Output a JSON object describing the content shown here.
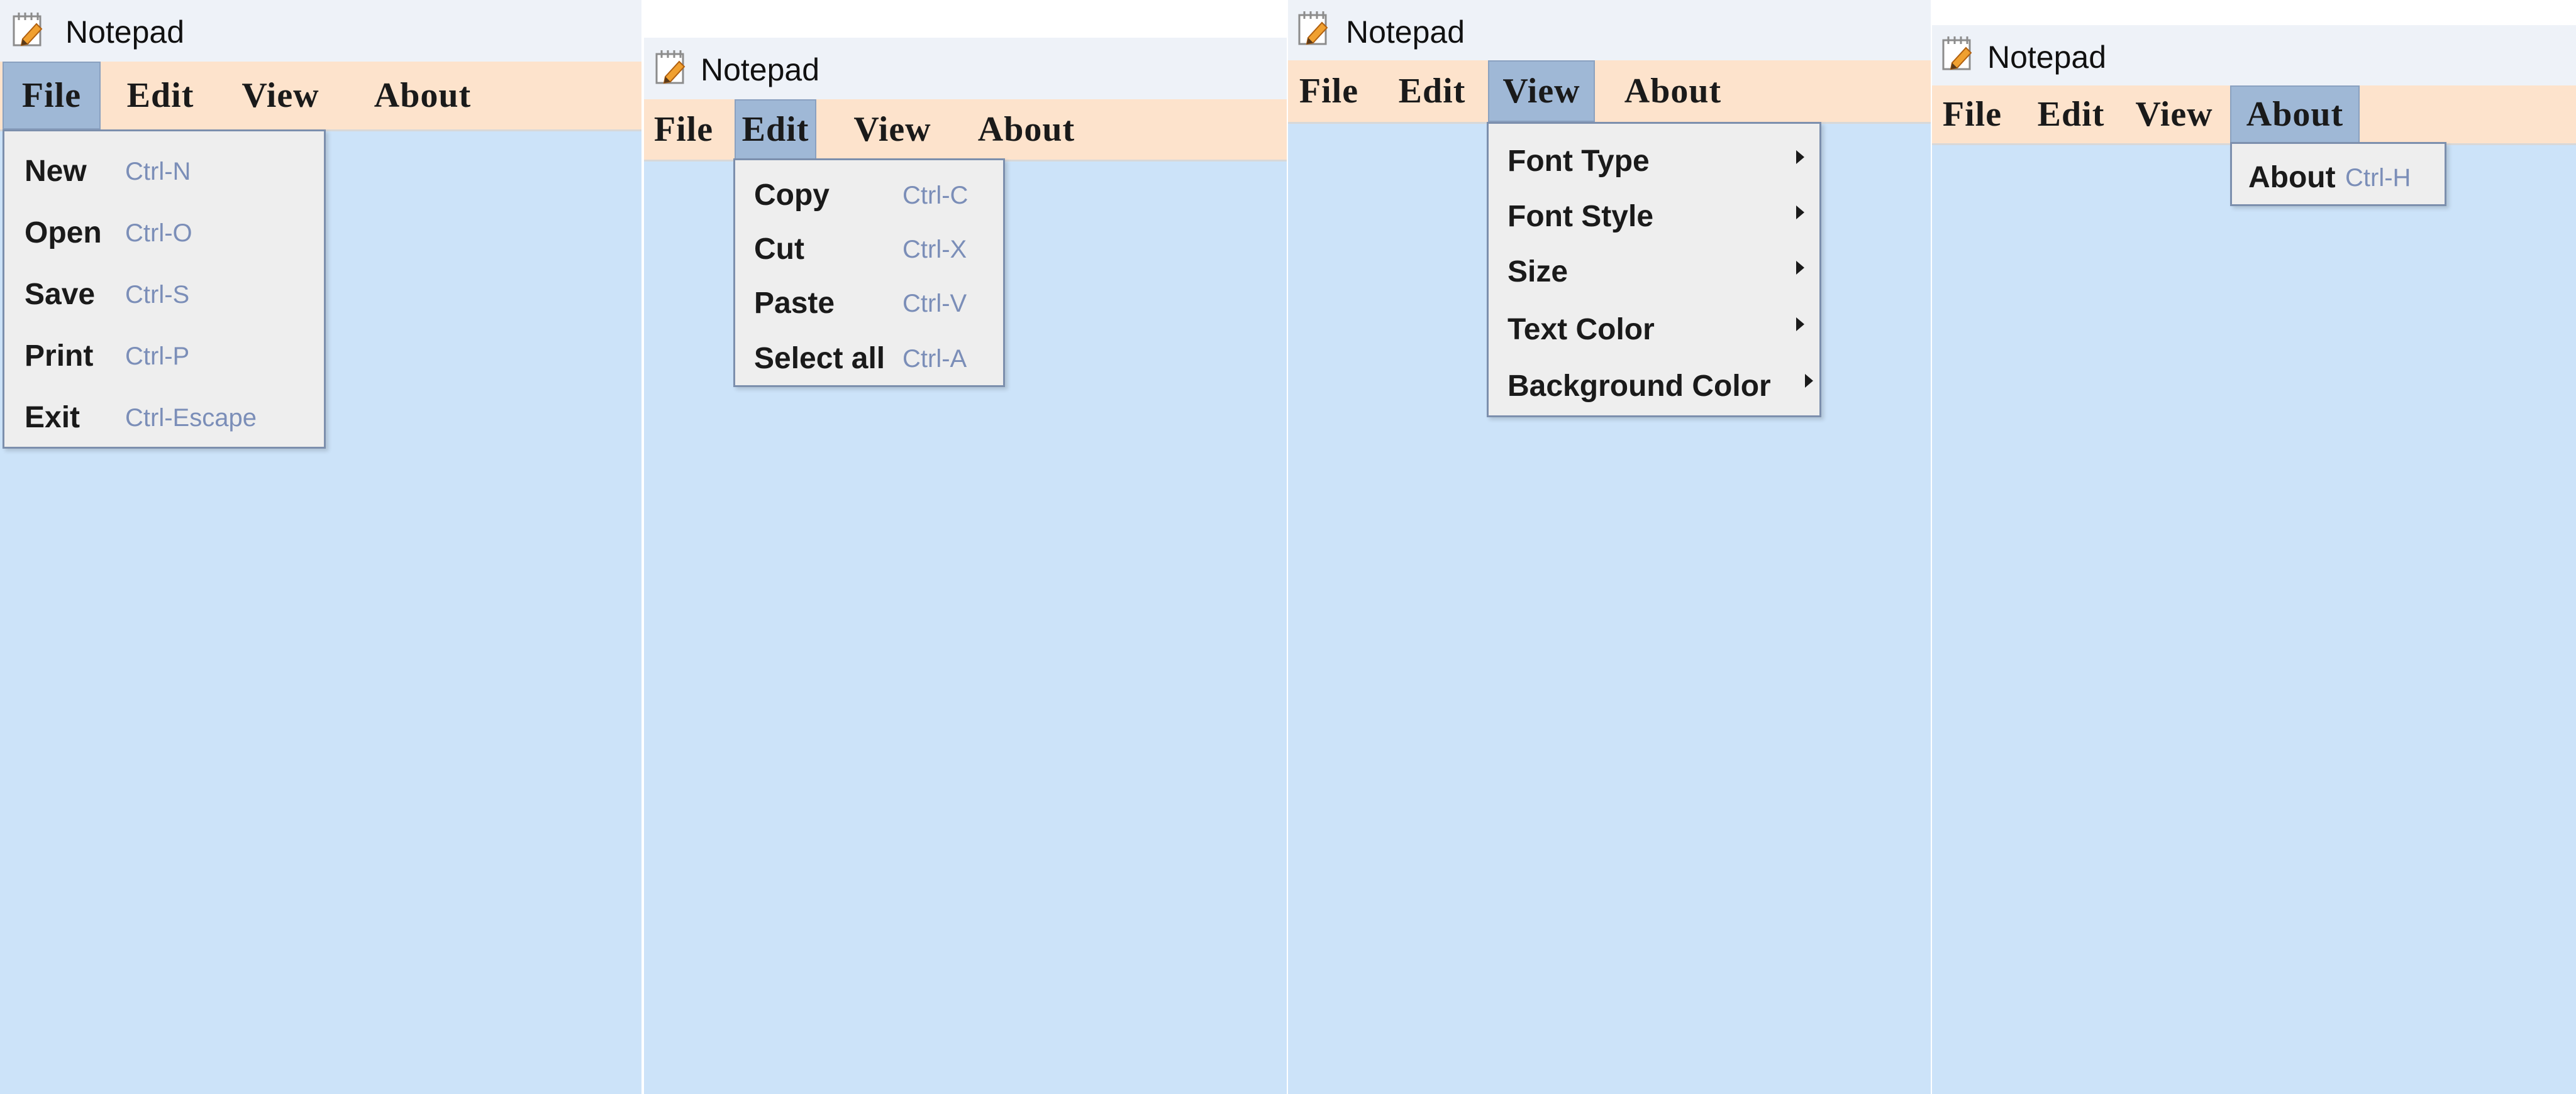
{
  "panels": [
    {
      "title": "Notepad",
      "menus": [
        "File",
        "Edit",
        "View",
        "About"
      ],
      "active_menu": "File",
      "dropdown": [
        {
          "label": "New",
          "shortcut": "Ctrl-N"
        },
        {
          "label": "Open",
          "shortcut": "Ctrl-O"
        },
        {
          "label": "Save",
          "shortcut": "Ctrl-S"
        },
        {
          "label": "Print",
          "shortcut": "Ctrl-P"
        },
        {
          "label": "Exit",
          "shortcut": "Ctrl-Escape"
        }
      ]
    },
    {
      "title": "Notepad",
      "menus": [
        "File",
        "Edit",
        "View",
        "About"
      ],
      "active_menu": "Edit",
      "dropdown": [
        {
          "label": "Copy",
          "shortcut": "Ctrl-C"
        },
        {
          "label": "Cut",
          "shortcut": "Ctrl-X"
        },
        {
          "label": "Paste",
          "shortcut": "Ctrl-V"
        },
        {
          "label": "Select all",
          "shortcut": "Ctrl-A"
        }
      ]
    },
    {
      "title": "Notepad",
      "menus": [
        "File",
        "Edit",
        "View",
        "About"
      ],
      "active_menu": "View",
      "dropdown": [
        {
          "label": "Font Type",
          "submenu": true
        },
        {
          "label": "Font Style",
          "submenu": true
        },
        {
          "label": "Size",
          "submenu": true
        },
        {
          "label": "Text Color",
          "submenu": true
        },
        {
          "label": "Background Color",
          "submenu": true
        }
      ]
    },
    {
      "title": "Notepad",
      "menus": [
        "File",
        "Edit",
        "View",
        "About"
      ],
      "active_menu": "About",
      "dropdown": [
        {
          "label": "About",
          "shortcut": "Ctrl-H"
        }
      ]
    }
  ],
  "colors": {
    "titlebar": "#eef2f8",
    "menubar": "#fde3cc",
    "menu_active": "#9fb8d6",
    "content": "#cce3f9",
    "dropdown_bg": "#eeeeee",
    "shortcut_text": "#7b8eb8"
  },
  "icons": {
    "app": "notepad-pencil-icon",
    "submenu": "submenu-arrow-icon"
  }
}
